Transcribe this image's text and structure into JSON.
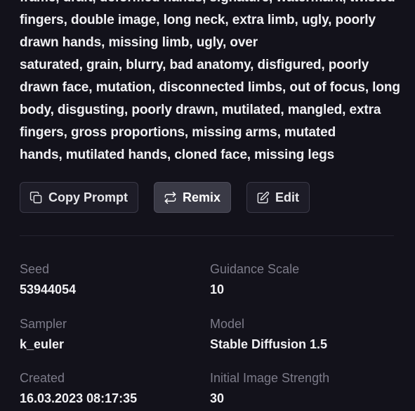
{
  "prompt": {
    "lines": [
      "frame, draft, deformed hands, signature, watermark, twisted",
      "fingers, double image, long neck, extra limb, ugly, poorly",
      "drawn hands, missing limb, ugly, over",
      "saturated, grain, blurry, bad anatomy, disfigured, poorly",
      "drawn face, mutation, disconnected limbs, out of focus, long",
      "body, disgusting, poorly drawn, mutilated, mangled, extra",
      "fingers, gross proportions, missing arms, mutated",
      "hands, mutilated hands, cloned face, missing legs"
    ]
  },
  "actions": {
    "copy_label": "Copy Prompt",
    "copy_icon": "copy-icon",
    "remix_label": "Remix",
    "remix_icon": "repeat-arrows-icon",
    "edit_label": "Edit",
    "edit_icon": "edit-pencil-icon"
  },
  "details": {
    "seed": {
      "label": "Seed",
      "value": "53944054"
    },
    "guidance_scale": {
      "label": "Guidance Scale",
      "value": "10"
    },
    "sampler": {
      "label": "Sampler",
      "value": "k_euler"
    },
    "model": {
      "label": "Model",
      "value": "Stable Diffusion 1.5"
    },
    "created": {
      "label": "Created",
      "value": "16.03.2023 08:17:35"
    },
    "initial_image_strength": {
      "label": "Initial Image Strength",
      "value": "30"
    }
  },
  "colors": {
    "background": "#13121b",
    "button_bg": "#1d1c27",
    "button_active_bg": "#3a3a46",
    "label_text": "#7c7b89",
    "value_text": "#f1f1f4"
  }
}
